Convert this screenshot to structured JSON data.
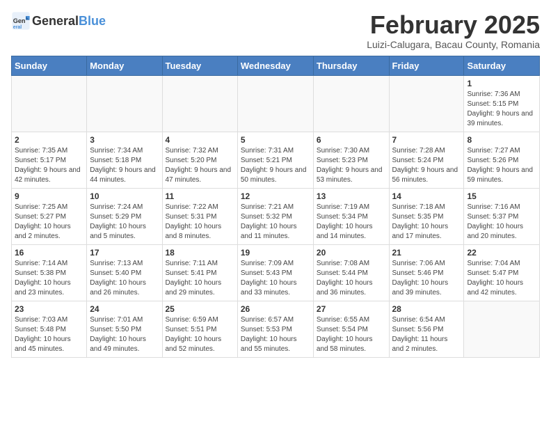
{
  "header": {
    "logo_general": "General",
    "logo_blue": "Blue",
    "title": "February 2025",
    "subtitle": "Luizi-Calugara, Bacau County, Romania"
  },
  "weekdays": [
    "Sunday",
    "Monday",
    "Tuesday",
    "Wednesday",
    "Thursday",
    "Friday",
    "Saturday"
  ],
  "weeks": [
    [
      {
        "day": "",
        "info": ""
      },
      {
        "day": "",
        "info": ""
      },
      {
        "day": "",
        "info": ""
      },
      {
        "day": "",
        "info": ""
      },
      {
        "day": "",
        "info": ""
      },
      {
        "day": "",
        "info": ""
      },
      {
        "day": "1",
        "info": "Sunrise: 7:36 AM\nSunset: 5:15 PM\nDaylight: 9 hours and 39 minutes."
      }
    ],
    [
      {
        "day": "2",
        "info": "Sunrise: 7:35 AM\nSunset: 5:17 PM\nDaylight: 9 hours and 42 minutes."
      },
      {
        "day": "3",
        "info": "Sunrise: 7:34 AM\nSunset: 5:18 PM\nDaylight: 9 hours and 44 minutes."
      },
      {
        "day": "4",
        "info": "Sunrise: 7:32 AM\nSunset: 5:20 PM\nDaylight: 9 hours and 47 minutes."
      },
      {
        "day": "5",
        "info": "Sunrise: 7:31 AM\nSunset: 5:21 PM\nDaylight: 9 hours and 50 minutes."
      },
      {
        "day": "6",
        "info": "Sunrise: 7:30 AM\nSunset: 5:23 PM\nDaylight: 9 hours and 53 minutes."
      },
      {
        "day": "7",
        "info": "Sunrise: 7:28 AM\nSunset: 5:24 PM\nDaylight: 9 hours and 56 minutes."
      },
      {
        "day": "8",
        "info": "Sunrise: 7:27 AM\nSunset: 5:26 PM\nDaylight: 9 hours and 59 minutes."
      }
    ],
    [
      {
        "day": "9",
        "info": "Sunrise: 7:25 AM\nSunset: 5:27 PM\nDaylight: 10 hours and 2 minutes."
      },
      {
        "day": "10",
        "info": "Sunrise: 7:24 AM\nSunset: 5:29 PM\nDaylight: 10 hours and 5 minutes."
      },
      {
        "day": "11",
        "info": "Sunrise: 7:22 AM\nSunset: 5:31 PM\nDaylight: 10 hours and 8 minutes."
      },
      {
        "day": "12",
        "info": "Sunrise: 7:21 AM\nSunset: 5:32 PM\nDaylight: 10 hours and 11 minutes."
      },
      {
        "day": "13",
        "info": "Sunrise: 7:19 AM\nSunset: 5:34 PM\nDaylight: 10 hours and 14 minutes."
      },
      {
        "day": "14",
        "info": "Sunrise: 7:18 AM\nSunset: 5:35 PM\nDaylight: 10 hours and 17 minutes."
      },
      {
        "day": "15",
        "info": "Sunrise: 7:16 AM\nSunset: 5:37 PM\nDaylight: 10 hours and 20 minutes."
      }
    ],
    [
      {
        "day": "16",
        "info": "Sunrise: 7:14 AM\nSunset: 5:38 PM\nDaylight: 10 hours and 23 minutes."
      },
      {
        "day": "17",
        "info": "Sunrise: 7:13 AM\nSunset: 5:40 PM\nDaylight: 10 hours and 26 minutes."
      },
      {
        "day": "18",
        "info": "Sunrise: 7:11 AM\nSunset: 5:41 PM\nDaylight: 10 hours and 29 minutes."
      },
      {
        "day": "19",
        "info": "Sunrise: 7:09 AM\nSunset: 5:43 PM\nDaylight: 10 hours and 33 minutes."
      },
      {
        "day": "20",
        "info": "Sunrise: 7:08 AM\nSunset: 5:44 PM\nDaylight: 10 hours and 36 minutes."
      },
      {
        "day": "21",
        "info": "Sunrise: 7:06 AM\nSunset: 5:46 PM\nDaylight: 10 hours and 39 minutes."
      },
      {
        "day": "22",
        "info": "Sunrise: 7:04 AM\nSunset: 5:47 PM\nDaylight: 10 hours and 42 minutes."
      }
    ],
    [
      {
        "day": "23",
        "info": "Sunrise: 7:03 AM\nSunset: 5:48 PM\nDaylight: 10 hours and 45 minutes."
      },
      {
        "day": "24",
        "info": "Sunrise: 7:01 AM\nSunset: 5:50 PM\nDaylight: 10 hours and 49 minutes."
      },
      {
        "day": "25",
        "info": "Sunrise: 6:59 AM\nSunset: 5:51 PM\nDaylight: 10 hours and 52 minutes."
      },
      {
        "day": "26",
        "info": "Sunrise: 6:57 AM\nSunset: 5:53 PM\nDaylight: 10 hours and 55 minutes."
      },
      {
        "day": "27",
        "info": "Sunrise: 6:55 AM\nSunset: 5:54 PM\nDaylight: 10 hours and 58 minutes."
      },
      {
        "day": "28",
        "info": "Sunrise: 6:54 AM\nSunset: 5:56 PM\nDaylight: 11 hours and 2 minutes."
      },
      {
        "day": "",
        "info": ""
      }
    ]
  ]
}
